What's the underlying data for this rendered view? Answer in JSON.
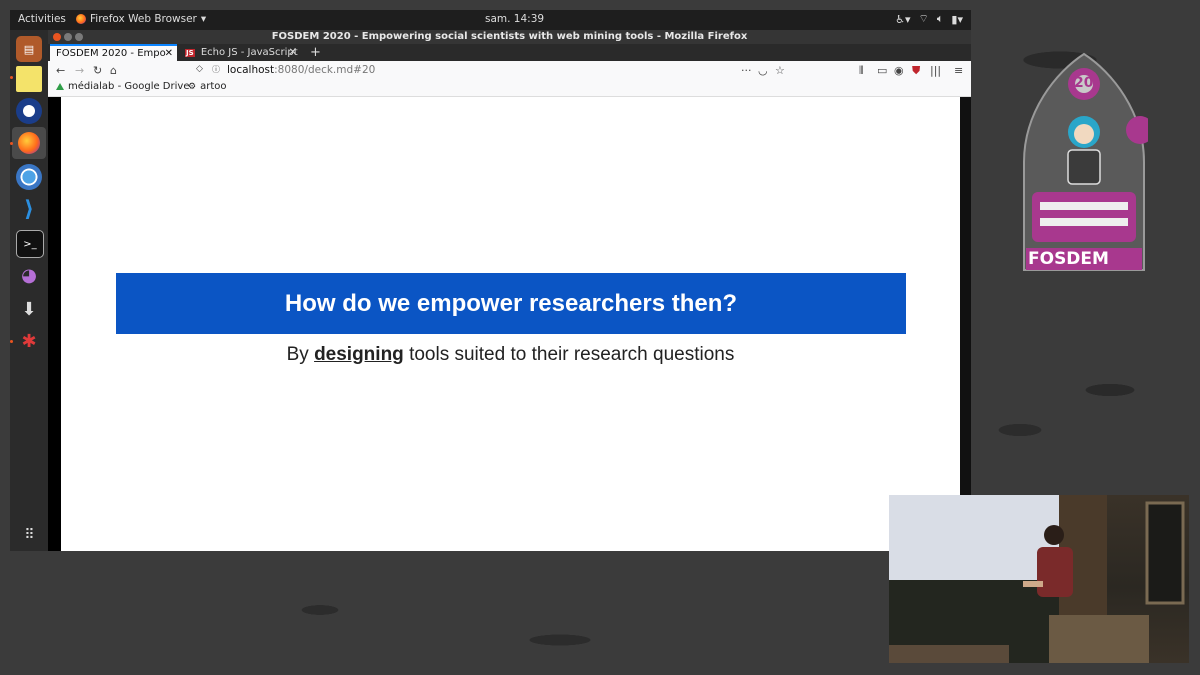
{
  "top_bar": {
    "activities": "Activities",
    "app_menu": "Firefox Web Browser",
    "clock": "sam. 14:39"
  },
  "window": {
    "title": "FOSDEM 2020 - Empowering social scientists with web mining tools - Mozilla Firefox"
  },
  "tabs": [
    {
      "label": "FOSDEM 2020 - Empo",
      "active": true
    },
    {
      "label": "Echo JS - JavaScript",
      "icon_text": "JS",
      "active": false
    }
  ],
  "new_tab_label": "+",
  "url": {
    "host": "localhost",
    "rest": ":8080/deck.md#20"
  },
  "bookmarks": [
    {
      "label": "médialab - Google Drive",
      "icon": "google-drive-icon"
    },
    {
      "label": "artoo",
      "icon": "gear-icon"
    }
  ],
  "slide": {
    "heading": "How do we empower researchers then?",
    "sub_before": "By ",
    "sub_emph": "designing",
    "sub_after": " tools suited to their research questions"
  },
  "logo": {
    "text": "FOSDEM",
    "badge": "20"
  },
  "colors": {
    "slide_heading_bg": "#0b55c4",
    "logo_purple": "#a8388e",
    "tab_accent": "#0a84ff"
  }
}
